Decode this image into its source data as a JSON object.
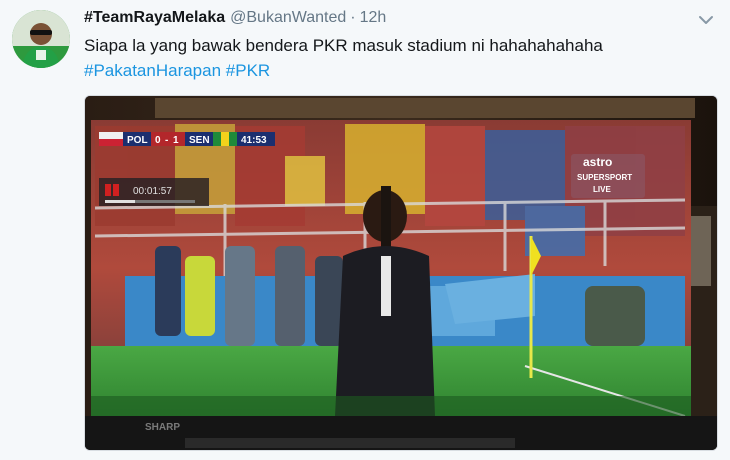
{
  "tweet": {
    "display_name": "#TeamRayaMelaka",
    "handle": "@BukanWanted",
    "separator": "·",
    "time": "12h",
    "text": "Siapa la yang bawak bendera PKR masuk stadium ni hahahahahaha",
    "hashtags": [
      "#PakatanHarapan",
      "#PKR"
    ],
    "menu_icon": "chevron-down-icon",
    "avatar_icon": "profile-avatar"
  },
  "media": {
    "scorebug": {
      "team_left": "POL",
      "score_left": "0",
      "score_right": "1",
      "team_right": "SEN",
      "clock": "41:53"
    },
    "recording_timer": "00:01:57",
    "broadcaster": {
      "logo": "astro",
      "line1": "SUPERSPORT",
      "line2": "LIVE"
    },
    "tv_brand": "SHARP"
  },
  "colors": {
    "hashtag": "#1b95e0",
    "text": "#14171a",
    "muted": "#657786",
    "background": "#f5f8fa",
    "pitch": "#3f9a3c"
  }
}
